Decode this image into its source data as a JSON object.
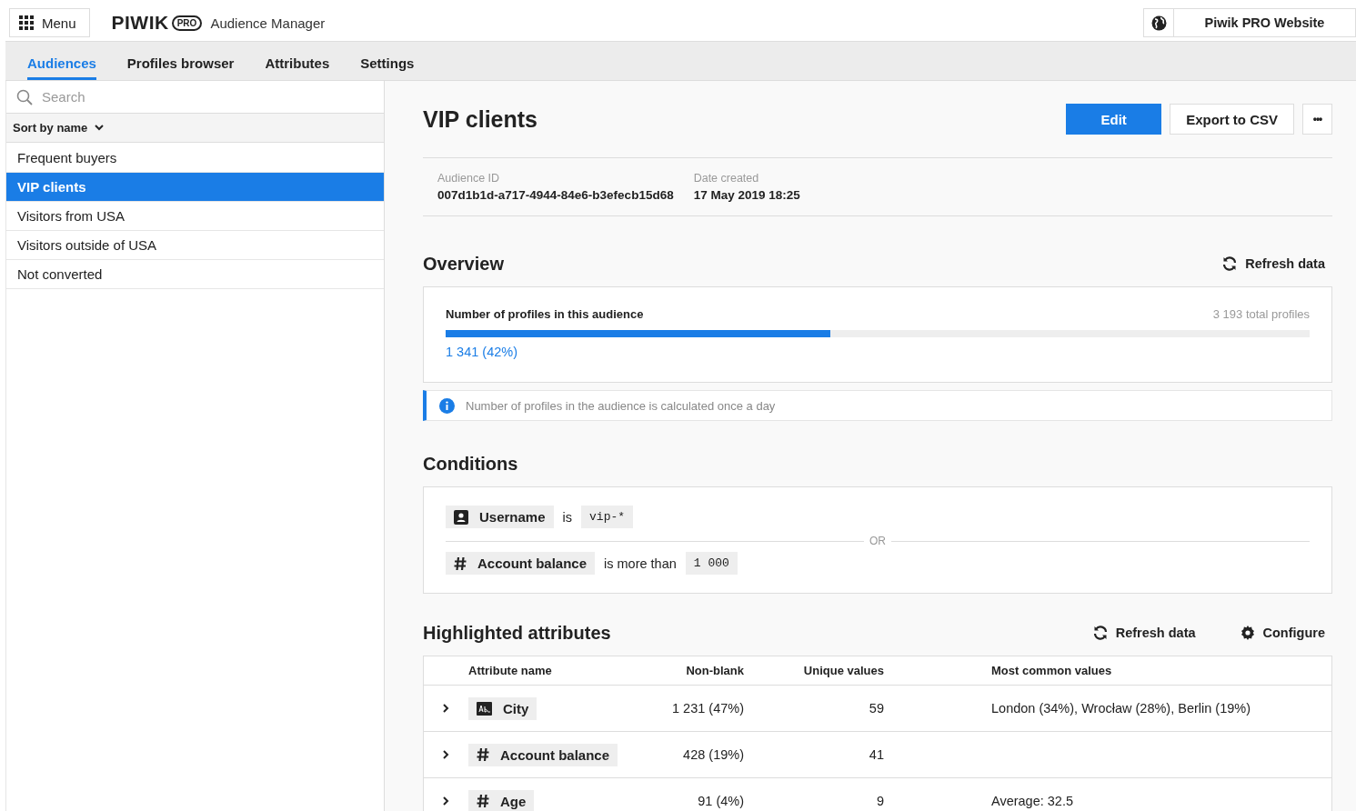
{
  "header": {
    "menu_label": "Menu",
    "logo": "PIWIK",
    "logo_badge": "PRO",
    "app_name": "Audience Manager",
    "website": "Piwik PRO Website"
  },
  "tabs": [
    {
      "label": "Audiences",
      "selected": true
    },
    {
      "label": "Profiles browser",
      "selected": false
    },
    {
      "label": "Attributes",
      "selected": false
    },
    {
      "label": "Settings",
      "selected": false
    }
  ],
  "sidebar": {
    "search": {
      "placeholder": "Search"
    },
    "sort_label": "Sort by name",
    "items": [
      {
        "label": "Frequent buyers",
        "selected": false
      },
      {
        "label": "VIP clients",
        "selected": true
      },
      {
        "label": "Visitors from USA",
        "selected": false
      },
      {
        "label": "Visitors outside of USA",
        "selected": false
      },
      {
        "label": "Not converted",
        "selected": false
      }
    ]
  },
  "detail": {
    "title": "VIP clients",
    "buttons": [
      {
        "label": "Edit",
        "kind": "primary"
      },
      {
        "label": "Export to CSV",
        "kind": "secondary"
      },
      {
        "label": "•••",
        "kind": "more"
      }
    ],
    "meta": [
      {
        "label": "Audience ID",
        "value": "007d1b1d-a717-4944-84e6-b3efecb15d68"
      },
      {
        "label": "Date created",
        "value": "17 May 2019 18:25"
      }
    ]
  },
  "overview": {
    "title": "Overview",
    "refresh_label": "Refresh data",
    "metric_label": "Number of profiles in this audience",
    "total": "3 193 total profiles",
    "level": 0.445,
    "value": "1 341 (42%)",
    "info": "Number of profiles in the audience is calculated once a day"
  },
  "conditions": {
    "title": "Conditions",
    "separator": "OR",
    "rows": [
      {
        "kind": "user",
        "attribute": "Username",
        "operator": "is",
        "value": "vip-*"
      },
      {
        "kind": "number",
        "attribute": "Account balance",
        "operator": "is more than",
        "value": "1 000"
      }
    ]
  },
  "attributes": {
    "title": "Highlighted attributes",
    "refresh_label": "Refresh data",
    "configure_label": "Configure",
    "columns": [
      "Attribute name",
      "Non-blank",
      "Unique values",
      "Most common values"
    ],
    "rows": [
      {
        "kind": "text",
        "expanded": false,
        "name": "City",
        "non_blank": "1 231 (47%)",
        "unique": "59",
        "common": "London (34%), Wrocław (28%), Berlin (19%)"
      },
      {
        "kind": "number",
        "expanded": false,
        "name": "Account balance",
        "non_blank": "428 (19%)",
        "unique": "41"
      },
      {
        "kind": "number",
        "expanded": false,
        "name": "Age",
        "non_blank": "91 (4%)",
        "unique": "9",
        "common": "Average: 32.5"
      }
    ]
  }
}
